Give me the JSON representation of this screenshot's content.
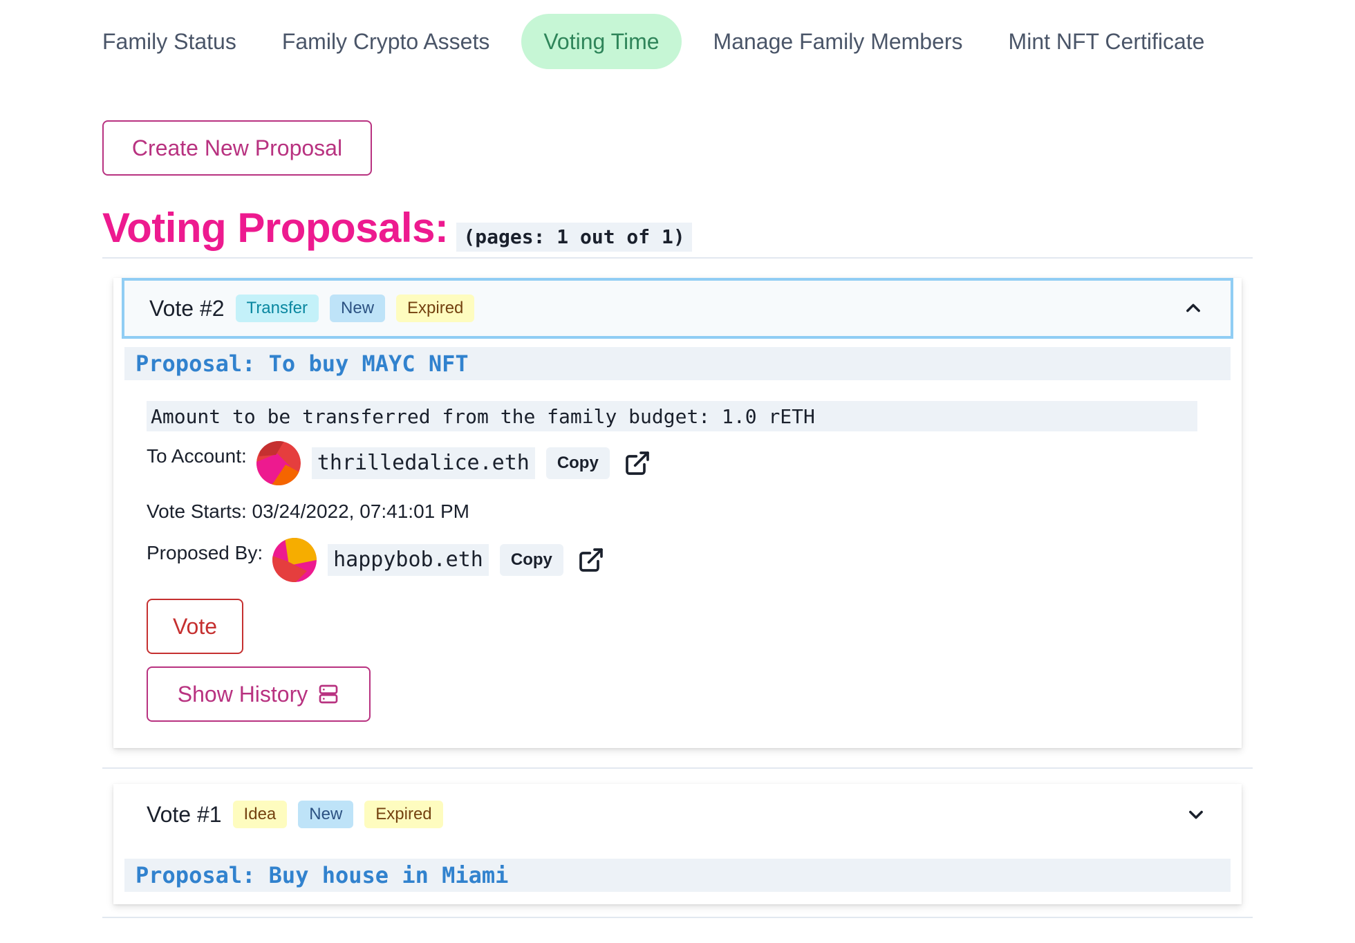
{
  "tabs": [
    {
      "label": "Family Status"
    },
    {
      "label": "Family Crypto Assets"
    },
    {
      "label": "Voting Time"
    },
    {
      "label": "Manage Family Members"
    },
    {
      "label": "Mint NFT Certificate"
    }
  ],
  "active_tab": "Voting Time",
  "create_button": "Create New Proposal",
  "heading": {
    "title": "Voting Proposals:",
    "pages": "(pages: 1 out of 1)"
  },
  "votes": [
    {
      "title": "Vote #2",
      "badges": [
        "Transfer",
        "New",
        "Expired"
      ],
      "proposal": "Proposal: To buy MAYC NFT",
      "expanded": true,
      "amount": "Amount to be transferred from the family budget: 1.0 rETH",
      "to_account_label": "To Account:",
      "to_account": "thrilledalice.eth",
      "vote_starts": "Vote Starts: 03/24/2022, 07:41:01 PM",
      "proposed_by_label": "Proposed By:",
      "proposed_by": "happybob.eth",
      "copy_label": "Copy",
      "vote_button": "Vote",
      "history_button": "Show History"
    },
    {
      "title": "Vote #1",
      "badges": [
        "Idea",
        "New",
        "Expired"
      ],
      "proposal": "Proposal: Buy house in Miami",
      "expanded": false
    }
  ],
  "colors": {
    "accent_pink": "#ed1a8f",
    "button_pink": "#b83280",
    "active_tab_bg": "#c6f6d5",
    "active_tab_text": "#2f855a",
    "proposal_blue": "#3182ce",
    "vote_red": "#c53030"
  },
  "icons": {
    "external_link": "external-link-icon",
    "history": "server-stack-icon",
    "collapse": "chevron-up-icon",
    "expand": "chevron-down-icon"
  }
}
